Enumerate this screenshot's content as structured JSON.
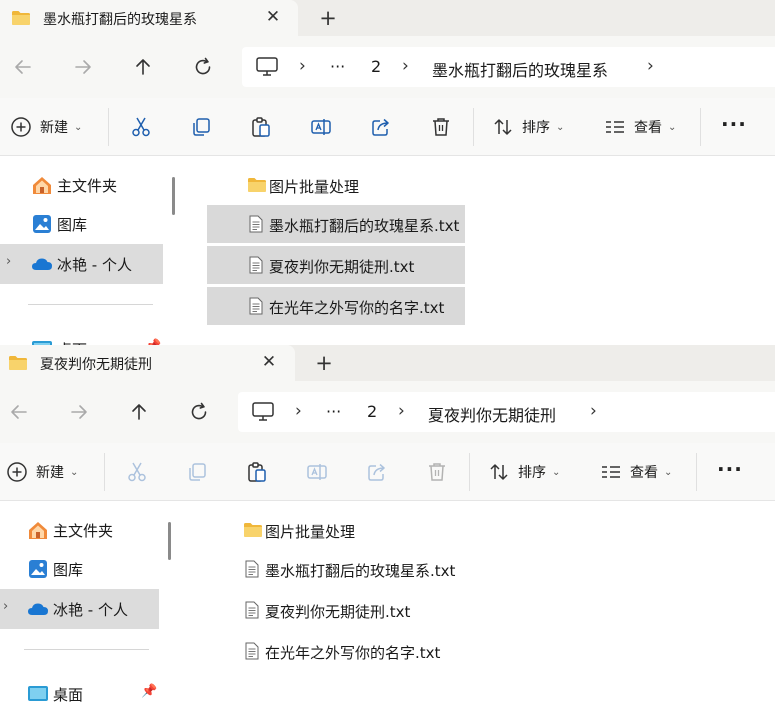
{
  "windows": [
    {
      "tab": {
        "title": "墨水瓶打翻后的玫瑰星系",
        "close": "✕",
        "add": "+"
      },
      "address": {
        "ellipsis": "···",
        "crumbs": [
          "2",
          "墨水瓶打翻后的玫瑰星系"
        ]
      },
      "toolbar": {
        "new_label": "新建",
        "sort_label": "排序",
        "view_label": "查看",
        "more": "···"
      },
      "sidebar": {
        "items": [
          {
            "label": "主文件夹",
            "icon": "home-icon"
          },
          {
            "label": "图库",
            "icon": "gallery-icon"
          },
          {
            "label": "冰艳 - 个人",
            "icon": "cloud-icon",
            "selected": true
          },
          {
            "label": "桌面",
            "icon": "desktop-icon"
          }
        ]
      },
      "files": [
        {
          "name": "图片批量处理",
          "type": "folder",
          "selected": false
        },
        {
          "name": "墨水瓶打翻后的玫瑰星系.txt",
          "type": "txt",
          "selected": true
        },
        {
          "name": "夏夜判你无期徒刑.txt",
          "type": "txt",
          "selected": true
        },
        {
          "name": "在光年之外写你的名字.txt",
          "type": "txt",
          "selected": true
        }
      ]
    },
    {
      "tab": {
        "title": "夏夜判你无期徒刑",
        "close": "✕",
        "add": "+"
      },
      "address": {
        "ellipsis": "···",
        "crumbs": [
          "2",
          "夏夜判你无期徒刑"
        ]
      },
      "toolbar": {
        "new_label": "新建",
        "sort_label": "排序",
        "view_label": "查看",
        "more": "···"
      },
      "sidebar": {
        "items": [
          {
            "label": "主文件夹",
            "icon": "home-icon"
          },
          {
            "label": "图库",
            "icon": "gallery-icon"
          },
          {
            "label": "冰艳 - 个人",
            "icon": "cloud-icon",
            "selected": true
          },
          {
            "label": "桌面",
            "icon": "desktop-icon"
          }
        ]
      },
      "files": [
        {
          "name": "图片批量处理",
          "type": "folder",
          "selected": false
        },
        {
          "name": "墨水瓶打翻后的玫瑰星系.txt",
          "type": "txt",
          "selected": false
        },
        {
          "name": "夏夜判你无期徒刑.txt",
          "type": "txt",
          "selected": false
        },
        {
          "name": "在光年之外写你的名字.txt",
          "type": "txt",
          "selected": false
        }
      ]
    }
  ],
  "colors": {
    "folder": "#f6c744",
    "accent": "#0067c0",
    "selection": "#d9d9d9"
  }
}
